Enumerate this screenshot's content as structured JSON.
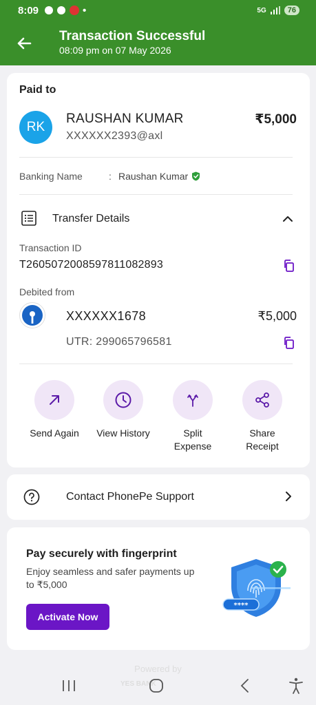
{
  "status_bar": {
    "time": "8:09",
    "dot": "•",
    "network": "5G",
    "battery": "76"
  },
  "header": {
    "title": "Transaction Successful",
    "subtitle": "08:09 pm on 07 May 2026"
  },
  "payment": {
    "paid_to_label": "Paid to",
    "avatar_initials": "RK",
    "payee_name": "RAUSHAN KUMAR",
    "payee_vpa": "XXXXXX2393@axl",
    "amount": "₹5,000",
    "banking_name_label": "Banking Name",
    "banking_name_colon": ":",
    "banking_name_value": "Raushan Kumar"
  },
  "transfer": {
    "title": "Transfer Details",
    "txn_id_label": "Transaction ID",
    "txn_id": "T2605072008597811082893",
    "debited_label": "Debited from",
    "account": "XXXXXX1678",
    "account_amount": "₹5,000",
    "utr": "UTR: 299065796581"
  },
  "actions": [
    {
      "label": "Send Again",
      "icon": "arrow-up-right-icon"
    },
    {
      "label": "View History",
      "icon": "clock-icon"
    },
    {
      "label": "Split Expense",
      "icon": "split-icon"
    },
    {
      "label": "Share Receipt",
      "icon": "share-icon"
    }
  ],
  "support": {
    "label": "Contact PhonePe Support"
  },
  "promo": {
    "title": "Pay securely with fingerprint",
    "description": "Enjoy seamless and safer payments up to ₹5,000",
    "button": "Activate Now",
    "pin_mask": "****"
  },
  "footer": {
    "powered_by": "Powered by",
    "bank": "YES BANK"
  },
  "colors": {
    "header_green": "#3a8f2a",
    "accent_purple": "#6b16c6",
    "avatar_blue": "#1aa3e8",
    "verified_green": "#2e9e3a"
  }
}
